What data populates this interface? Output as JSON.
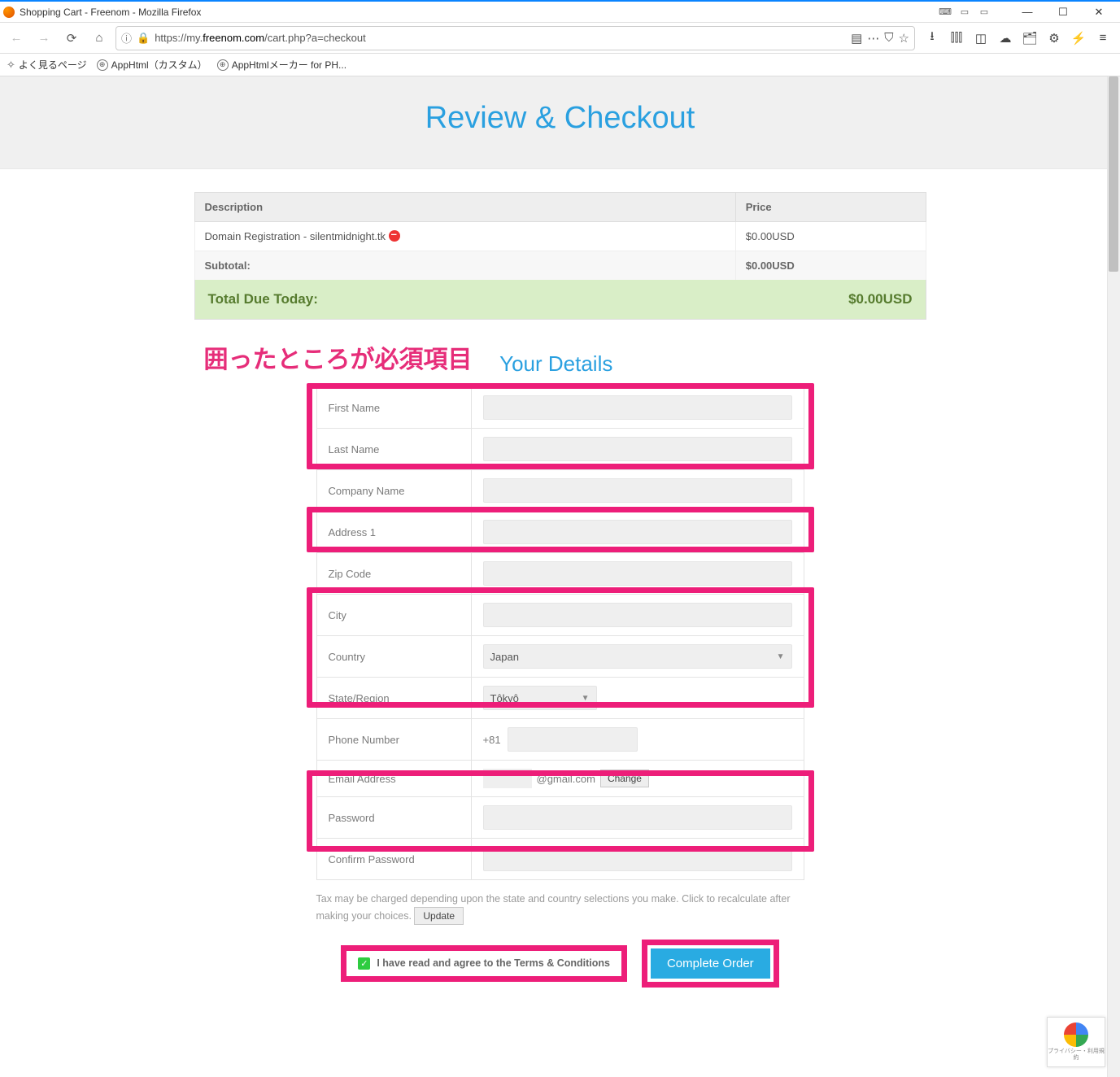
{
  "window": {
    "title": "Shopping Cart - Freenom - Mozilla Firefox"
  },
  "urlbar": {
    "prefix": "https://my.",
    "host": "freenom.com",
    "path": "/cart.php?a=checkout"
  },
  "bookmarks": {
    "frequent": "よく見るページ",
    "b1": "AppHtml（カスタム）",
    "b2": "AppHtmlメーカー for PH..."
  },
  "page": {
    "title": "Review & Checkout"
  },
  "cart": {
    "head_desc": "Description",
    "head_price": "Price",
    "item_label": "Domain Registration - silentmidnight.tk ",
    "item_price": "$0.00USD",
    "subtotal_label": "Subtotal:",
    "subtotal_price": "$0.00USD",
    "total_label": "Total Due Today:",
    "total_price": "$0.00USD"
  },
  "annotation": "囲ったところが必須項目",
  "details": {
    "title": "Your Details",
    "firstname": "First Name",
    "lastname": "Last Name",
    "company": "Company Name",
    "address1": "Address 1",
    "zip": "Zip Code",
    "city": "City",
    "country_label": "Country",
    "country_value": "Japan",
    "state_label": "State/Region",
    "state_value": "Tôkyô",
    "phone_label": "Phone Number",
    "phone_prefix": "+81",
    "email_label": "Email Address",
    "email_suffix": "@gmail.com",
    "change": "Change",
    "password": "Password",
    "confirm": "Confirm Password"
  },
  "tax": {
    "note": "Tax may be charged depending upon the state and country selections you make. Click to recalculate after making your choices. ",
    "update": "Update"
  },
  "footer": {
    "agree_pre": "I have read and agree to the ",
    "agree_link": "Terms & Conditions",
    "complete": "Complete Order"
  },
  "recaptcha": "プライバシー・利用規約"
}
